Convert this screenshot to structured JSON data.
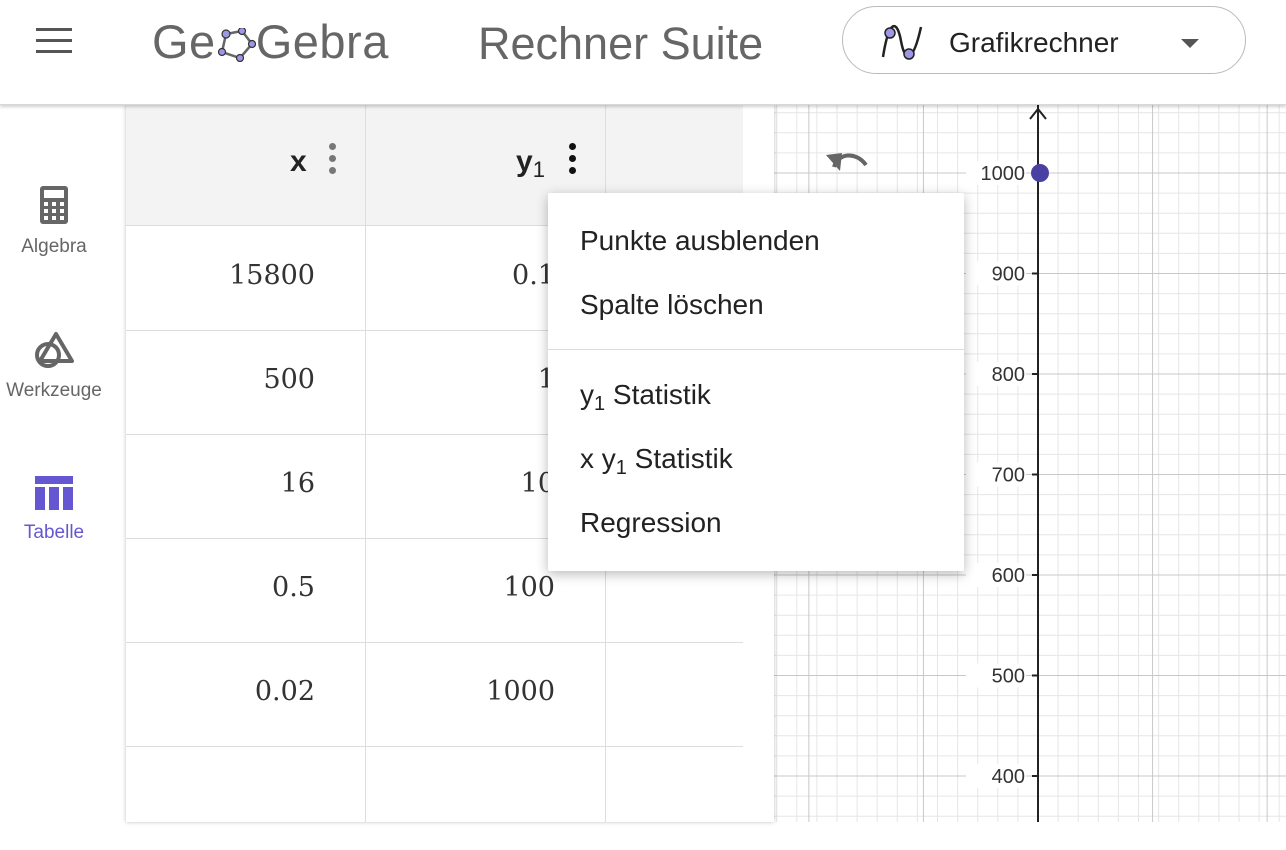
{
  "header": {
    "logo_left": "Ge",
    "logo_right": "Gebra",
    "suite_title": "Rechner Suite",
    "app_label": "Grafikrechner"
  },
  "sidebar": {
    "items": [
      {
        "label": "Algebra"
      },
      {
        "label": "Werkzeuge"
      },
      {
        "label": "Tabelle"
      }
    ]
  },
  "table": {
    "col_x": "x",
    "col_y": "y",
    "col_y_sub": "1",
    "rows": [
      {
        "x": "15800",
        "y": "0.1"
      },
      {
        "x": "500",
        "y": "1"
      },
      {
        "x": "16",
        "y": "10"
      },
      {
        "x": "0.5",
        "y": "100"
      },
      {
        "x": "0.02",
        "y": "1000"
      }
    ]
  },
  "graph": {
    "y_ticks": [
      "1000",
      "900",
      "800",
      "700",
      "600",
      "500",
      "400"
    ],
    "point_color": "#4a3fa3"
  },
  "context_menu": {
    "items": [
      "Punkte ausblenden",
      "Spalte löschen"
    ],
    "stats_y": "y",
    "stats_sub": "1",
    "stats_label": " Statistik",
    "stats_xy_prefix": "x y",
    "regression": "Regression"
  },
  "colors": {
    "accent": "#6557d2"
  }
}
